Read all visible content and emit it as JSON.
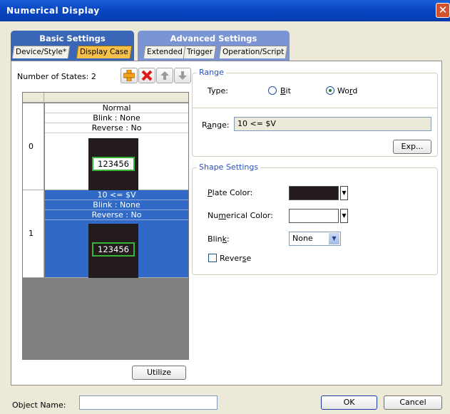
{
  "window": {
    "title": "Numerical Display",
    "close_glyph": "✕"
  },
  "tabs": {
    "groups": [
      {
        "label": "Basic Settings",
        "tabs": [
          "Device/Style*",
          "Display Case"
        ]
      },
      {
        "label": "Advanced Settings",
        "tabs": [
          "Extended",
          "Trigger",
          "Operation/Script"
        ]
      }
    ],
    "active": "Display Case"
  },
  "states": {
    "count_label": "Number of States:",
    "count": "2",
    "toolbar": {
      "add_icon": "add-plus-icon",
      "delete_icon": "delete-x-icon",
      "up_icon": "arrow-up-icon",
      "down_icon": "arrow-down-icon"
    },
    "items": [
      {
        "index": "0",
        "condition": "Normal",
        "blink": "Blink : None",
        "reverse": "Reverse : No",
        "preview_value": "123456"
      },
      {
        "index": "1",
        "condition": "10 <= $V",
        "blink": "Blink : None",
        "reverse": "Reverse : No",
        "preview_value": "123456"
      }
    ],
    "selected_index": 1,
    "utilize_label": "Utilize"
  },
  "range": {
    "legend": "Range",
    "type_label": "Type:",
    "type_options": [
      "Bit",
      "Word"
    ],
    "type_selected": "Word",
    "range_label": "Range:",
    "range_value": "10 <= $V",
    "exp_label": "Exp..."
  },
  "shape": {
    "legend": "Shape Settings",
    "plate_color_label": "Plate Color:",
    "plate_color": "#241c1c",
    "numerical_color_label": "Numerical Color:",
    "numerical_color": "#ffffff",
    "blink_label": "Blink:",
    "blink_value": "None",
    "reverse_label": "Reverse",
    "reverse_checked": false
  },
  "footer": {
    "object_name_label": "Object Name:",
    "object_name_value": "",
    "ok_label": "OK",
    "cancel_label": "Cancel"
  },
  "colors": {
    "title_bar": "#0a48c4",
    "selected_row": "#3169c6",
    "active_tab": "#f7c04a",
    "basic_group": "#3a66b8",
    "advanced_group": "#7b95d4"
  }
}
